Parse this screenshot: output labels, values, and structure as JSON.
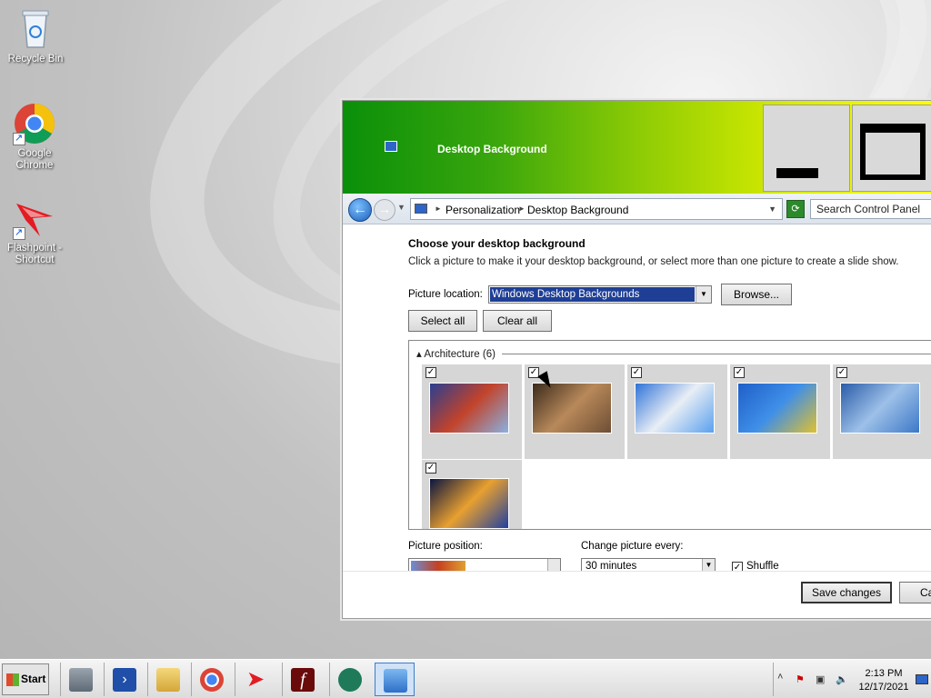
{
  "desktop": {
    "icons": [
      {
        "label": "Recycle Bin"
      },
      {
        "label": "Google Chrome"
      },
      {
        "label": "Flashpoint - Shortcut"
      }
    ]
  },
  "window": {
    "title": "Desktop Background",
    "address": {
      "crumb1": "Personalization",
      "crumb2": "Desktop Background",
      "search_placeholder": "Search Control Panel"
    },
    "heading": "Choose your desktop background",
    "description": "Click a picture to make it your desktop background, or select more than one picture to create a slide show.",
    "picture_location_label": "Picture location:",
    "picture_location_value": "Windows Desktop Backgrounds",
    "browse_label": "Browse...",
    "select_all_label": "Select all",
    "clear_all_label": "Clear all",
    "group": {
      "label": "Architecture (6)",
      "collapse_glyph": "▴"
    },
    "thumbnails": [
      {
        "checked": true,
        "colors": [
          "#2a3f8f",
          "#c2432b",
          "#8ab1e0"
        ]
      },
      {
        "checked": true,
        "colors": [
          "#3b2a1c",
          "#b8895a",
          "#6e4e34"
        ]
      },
      {
        "checked": true,
        "colors": [
          "#2f74d8",
          "#e9eef5",
          "#5aa0ee"
        ]
      },
      {
        "checked": true,
        "colors": [
          "#1f5fc8",
          "#3f8fe8",
          "#e0c030"
        ]
      },
      {
        "checked": true,
        "colors": [
          "#2a5ca8",
          "#9dc0e8",
          "#3c78c8"
        ]
      },
      {
        "checked": true,
        "colors": [
          "#0a1540",
          "#e8a030",
          "#2040a0"
        ]
      }
    ],
    "picture_position_label": "Picture position:",
    "change_every_label": "Change picture every:",
    "change_every_value": "30 minutes",
    "shuffle_label": "Shuffle",
    "save_label": "Save changes",
    "cancel_label": "Ca"
  },
  "taskbar": {
    "start_label": "Start",
    "time": "2:13 PM",
    "date": "12/17/2021"
  }
}
